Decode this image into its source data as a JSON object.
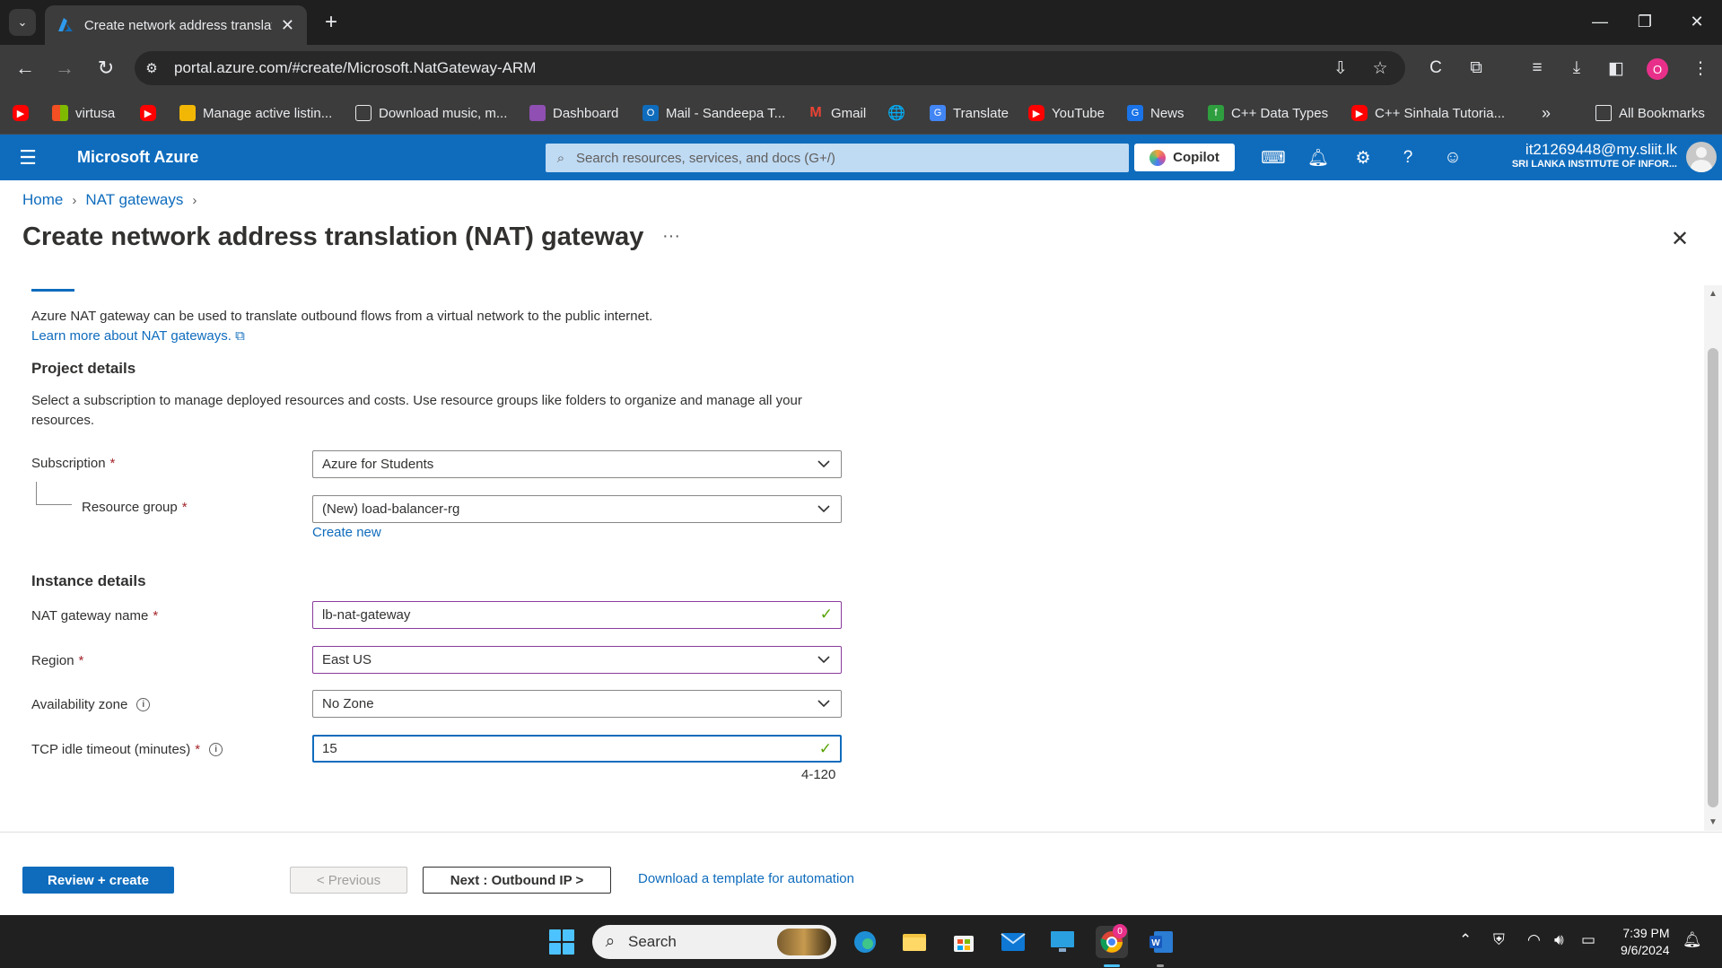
{
  "browser": {
    "tab_title": "Create network address translat",
    "url": "portal.azure.com/#create/Microsoft.NatGateway-ARM",
    "profile_initial": "O",
    "bookmarks": [
      "virtusa",
      "Manage active listin...",
      "Download music, m...",
      "Dashboard",
      "Mail - Sandeepa T...",
      "Gmail",
      "Translate",
      "YouTube",
      "News",
      "C++ Data Types",
      "C++ Sinhala Tutoria..."
    ],
    "all_bookmarks": "All Bookmarks"
  },
  "azure": {
    "brand": "Microsoft Azure",
    "search_placeholder": "Search resources, services, and docs (G+/)",
    "copilot": "Copilot",
    "account_email": "it21269448@my.sliit.lk",
    "account_org": "SRI LANKA INSTITUTE OF INFOR..."
  },
  "page": {
    "breadcrumb": [
      "Home",
      "NAT gateways"
    ],
    "title": "Create network address translation (NAT) gateway",
    "intro": "Azure NAT gateway can be used to translate outbound flows from a virtual network to the public internet.",
    "learn_more": "Learn more about NAT gateways.",
    "project_details": "Project details",
    "project_desc": "Select a subscription to manage deployed resources and costs. Use resource groups like folders to organize and manage all your resources.",
    "instance_details": "Instance details",
    "create_new": "Create new",
    "range_hint": "4-120"
  },
  "form": {
    "subscription": {
      "label": "Subscription",
      "value": "Azure for Students"
    },
    "resource_group": {
      "label": "Resource group",
      "value": "(New) load-balancer-rg"
    },
    "nat_name": {
      "label": "NAT gateway name",
      "value": "lb-nat-gateway"
    },
    "region": {
      "label": "Region",
      "value": "East US"
    },
    "zone": {
      "label": "Availability zone",
      "value": "No Zone"
    },
    "timeout": {
      "label": "TCP idle timeout (minutes)",
      "value": "15"
    }
  },
  "footer": {
    "review_create": "Review + create",
    "previous": "< Previous",
    "next": "Next : Outbound IP >",
    "download_template": "Download a template for automation"
  },
  "taskbar": {
    "search": "Search",
    "time": "7:39 PM",
    "date": "9/6/2024",
    "chrome_badge": "0"
  },
  "colors": {
    "azure_blue": "#0f6cbd",
    "required": "#a4262c",
    "valid_check": "#57a300"
  }
}
